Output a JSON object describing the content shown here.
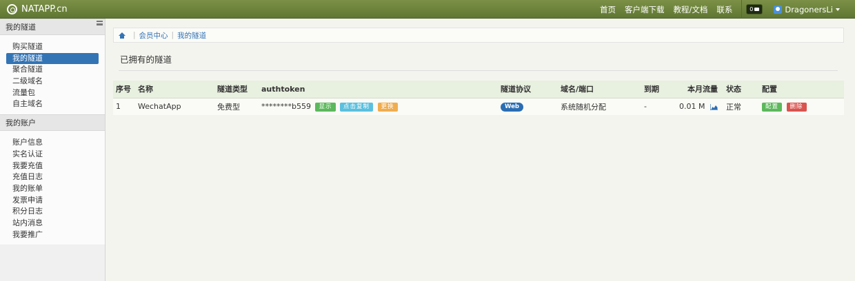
{
  "navbar": {
    "brand": "NATAPP.cn",
    "links": [
      "首页",
      "客户端下载",
      "教程/文档",
      "联系"
    ],
    "message_count": "0",
    "user_name": "DragonersLi"
  },
  "sidebar": {
    "sections": [
      {
        "title": "我的隧道",
        "items": [
          "购买隧道",
          "我的隧道",
          "聚合隧道",
          "二级域名",
          "流量包",
          "自主域名"
        ]
      },
      {
        "title": "我的账户",
        "items": [
          "账户信息",
          "实名认证",
          "我要充值",
          "充值日志",
          "我的账单",
          "发票申请",
          "积分日志",
          "站内消息",
          "我要推广"
        ]
      }
    ],
    "active_item": "我的隧道"
  },
  "breadcrumb": [
    "会员中心",
    "我的隧道"
  ],
  "panel_title": "已拥有的隧道",
  "table": {
    "headers": [
      "序号",
      "名称",
      "隧道类型",
      "authtoken",
      "隧道协议",
      "域名/端口",
      "到期",
      "本月流量",
      "状态",
      "配置"
    ],
    "rows": [
      {
        "index": "1",
        "name": "WechatApp",
        "type": "免费型",
        "authtoken": "********b559",
        "token_buttons": [
          "显示",
          "点击复制",
          "更换"
        ],
        "protocol": "Web",
        "domain": "系统随机分配",
        "expiry": "-",
        "traffic": "0.01 M",
        "status": "正常",
        "config_buttons": [
          "配置",
          "删除"
        ]
      }
    ]
  },
  "colors": {
    "navbar": "#6b8139",
    "active": "#3374b5",
    "show_button": "#5cb85c",
    "copy_button": "#5bc0de",
    "change_button": "#f0ad4e",
    "delete_button": "#d9534f"
  }
}
